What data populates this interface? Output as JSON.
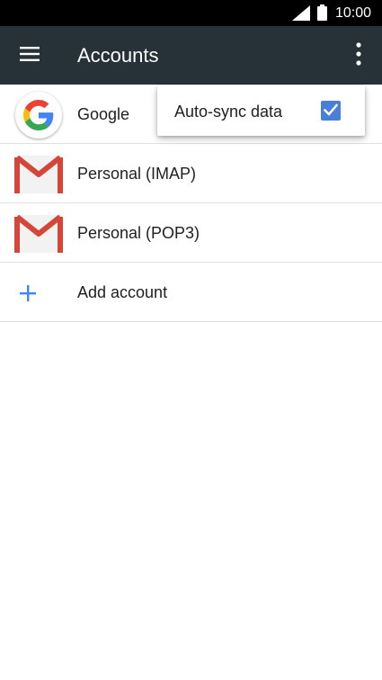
{
  "status_bar": {
    "time": "10:00",
    "signal_icon": "signal-icon",
    "battery_icon": "battery-icon"
  },
  "app_bar": {
    "title": "Accounts",
    "menu_icon": "hamburger-menu-icon",
    "overflow_icon": "overflow-menu-icon",
    "background": "#263238"
  },
  "accounts": [
    {
      "label": "Google",
      "icon": "google-icon"
    },
    {
      "label": "Personal (IMAP)",
      "icon": "gmail-icon"
    },
    {
      "label": "Personal (POP3)",
      "icon": "gmail-icon"
    }
  ],
  "add_account": {
    "label": "Add account",
    "icon": "plus-icon",
    "color": "#4285f4"
  },
  "popup_menu": {
    "item_label": "Auto-sync data",
    "checked": true,
    "checkbox_color": "#4a7fd6"
  }
}
